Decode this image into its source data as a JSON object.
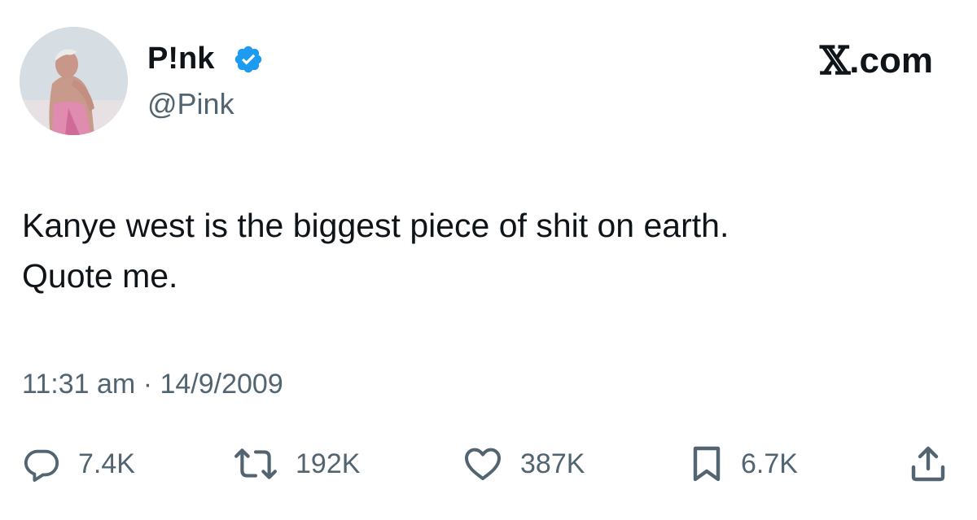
{
  "author": {
    "display_name": "P!nk",
    "handle": "@Pink",
    "verified": true,
    "avatar_icon": "profile-photo"
  },
  "brand": {
    "mark": "𝕏",
    "domain": ".com"
  },
  "tweet": {
    "lines": [
      "Kanye west is the biggest piece of shit on earth.",
      "Quote me."
    ],
    "time": "11:31 am",
    "separator": "·",
    "date": "14/9/2009"
  },
  "actions": {
    "replies": {
      "icon": "reply-icon",
      "count": "7.4K"
    },
    "reposts": {
      "icon": "repost-icon",
      "count": "192K"
    },
    "likes": {
      "icon": "heart-icon",
      "count": "387K"
    },
    "bookmarks": {
      "icon": "bookmark-icon",
      "count": "6.7K"
    },
    "share": {
      "icon": "share-icon"
    }
  },
  "colors": {
    "text_primary": "#0f1419",
    "text_secondary": "#536471",
    "verified_blue": "#1d9bf0",
    "background": "#ffffff"
  }
}
